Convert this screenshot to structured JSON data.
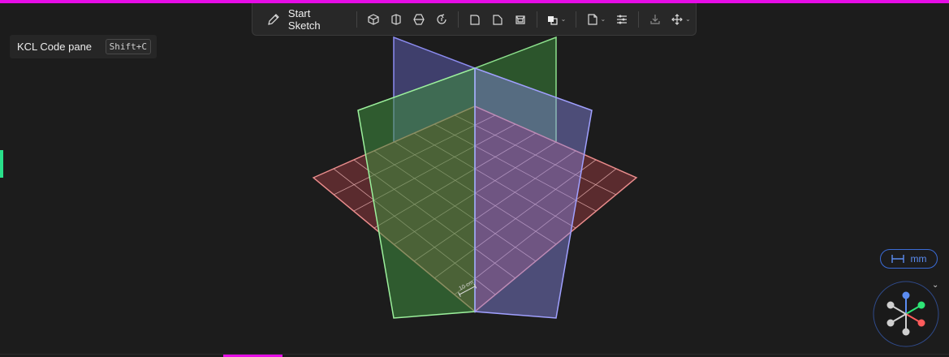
{
  "toolbar": {
    "start_sketch_label": "Start Sketch",
    "icons": [
      "pencil-icon",
      "extrude-icon",
      "sweep-icon",
      "loft-icon",
      "revolve-icon",
      "fillet-icon",
      "chamfer-icon",
      "shell-icon",
      "boolean-icon",
      "plane-icon",
      "pattern-icon",
      "insert-icon",
      "move-icon"
    ]
  },
  "kcl_pane": {
    "label": "KCL Code pane",
    "shortcut": "Shift+C"
  },
  "scale": {
    "label": "10 cm"
  },
  "units": {
    "label": "mm"
  },
  "colors": {
    "accent_top": "#e60ce6",
    "accent_left": "#29e08b",
    "xz_plane": "#3a8a3a",
    "yz_plane": "#6e6ee0",
    "xy_plane": "#e06666",
    "axis_x": "#ff5c5c",
    "axis_y": "#2ee676",
    "axis_z": "#5b8cf0"
  }
}
